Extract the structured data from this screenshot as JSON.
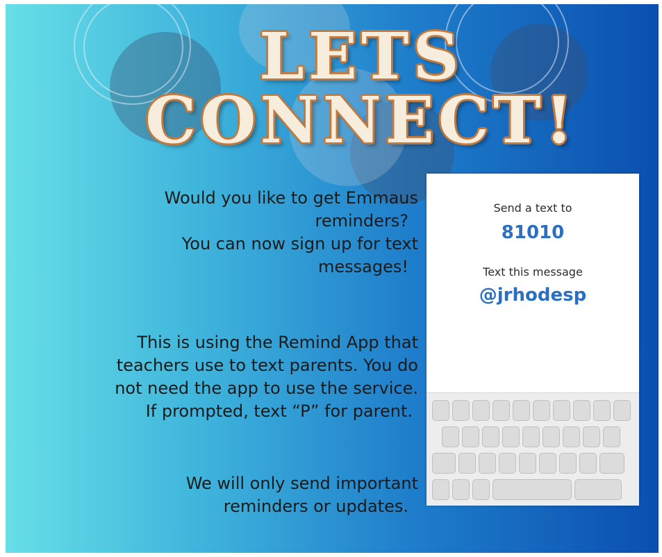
{
  "headline": {
    "line1": "LETS",
    "line2": "CONNECT!"
  },
  "body": {
    "paragraph1": [
      "Would you like to get Emmaus",
      "reminders?",
      "You can now sign up for text",
      "messages!"
    ],
    "paragraph2": [
      "This is using the Remind App that",
      "teachers use to text parents. You do",
      "not need the app to use the service.",
      "If prompted, text “P” for parent."
    ],
    "paragraph3": [
      "We will only send important",
      "reminders or updates."
    ]
  },
  "phone": {
    "send_label": "Send a text to",
    "number": "81010",
    "message_label": "Text this message",
    "code": "@jrhodesp"
  },
  "colors": {
    "gradient_left": "#67dfe6",
    "gradient_right": "#0a4fb0",
    "headline_fill": "#f7eddc",
    "headline_outline": "#c07a3f",
    "code_blue": "#2a6fc0"
  }
}
